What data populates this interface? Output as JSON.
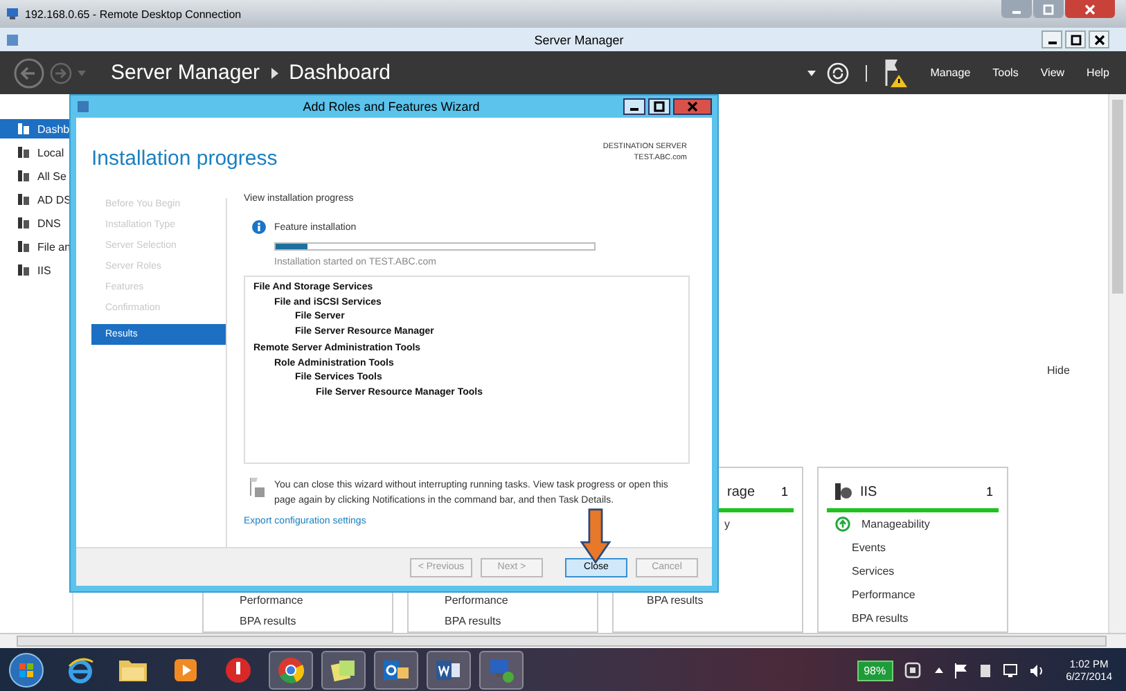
{
  "rdp_window": {
    "title": "192.168.0.65 - Remote Desktop Connection"
  },
  "app_window": {
    "title": "Server Manager"
  },
  "header": {
    "breadcrumb": [
      "Server Manager",
      "Dashboard"
    ],
    "menu": [
      "Manage",
      "Tools",
      "View",
      "Help"
    ]
  },
  "sidebar": {
    "items": [
      {
        "label": "Dashb",
        "selected": true
      },
      {
        "label": "Local",
        "selected": false
      },
      {
        "label": "All Se",
        "selected": false
      },
      {
        "label": "AD DS",
        "selected": false
      },
      {
        "label": "DNS",
        "selected": false
      },
      {
        "label": "File an",
        "selected": false
      },
      {
        "label": "IIS",
        "selected": false
      }
    ]
  },
  "dashboard": {
    "hide_link": "Hide",
    "tiles": [
      {
        "rows": [
          {
            "text": "Performance",
            "kind": "link"
          },
          {
            "text": "BPA results",
            "kind": "link"
          }
        ]
      },
      {
        "rows": [
          {
            "text": "Performance",
            "kind": "link"
          },
          {
            "text": "BPA results",
            "kind": "link"
          }
        ]
      },
      {
        "title": "rage",
        "count": "1",
        "rows": [
          {
            "text": "y",
            "kind": "link"
          },
          {
            "text": "BPA results",
            "kind": "link"
          }
        ]
      },
      {
        "title": "IIS",
        "count": "1",
        "rows": [
          {
            "text": "Manageability",
            "kind": "healthy"
          },
          {
            "text": "Events",
            "kind": "link"
          },
          {
            "text": "Services",
            "kind": "link"
          },
          {
            "text": "Performance",
            "kind": "link"
          },
          {
            "text": "BPA results",
            "kind": "link"
          }
        ]
      }
    ]
  },
  "wizard": {
    "title": "Add Roles and Features Wizard",
    "heading": "Installation progress",
    "destination_label": "DESTINATION SERVER",
    "destination_server": "TEST.ABC.com",
    "steps": [
      {
        "label": "Before You Begin",
        "selected": false
      },
      {
        "label": "Installation Type",
        "selected": false
      },
      {
        "label": "Server Selection",
        "selected": false
      },
      {
        "label": "Server Roles",
        "selected": false
      },
      {
        "label": "Features",
        "selected": false
      },
      {
        "label": "Confirmation",
        "selected": false
      },
      {
        "label": "Results",
        "selected": true
      }
    ],
    "section_label": "View installation progress",
    "status": "Feature installation",
    "level": 0.1,
    "started": "Installation started on TEST.ABC.com",
    "results": [
      {
        "label": "File And Storage Services",
        "children": [
          {
            "label": "File and iSCSI Services",
            "children": [
              {
                "label": "File Server"
              },
              {
                "label": "File Server Resource Manager"
              }
            ]
          }
        ]
      },
      {
        "label": "Remote Server Administration Tools",
        "children": [
          {
            "label": "Role Administration Tools",
            "children": [
              {
                "label": "File Services Tools",
                "children": [
                  {
                    "label": "File Server Resource Manager Tools"
                  }
                ]
              }
            ]
          }
        ]
      }
    ],
    "note": "You can close this wizard without interrupting running tasks. View task progress or open this page again by clicking Notifications in the command bar, and then Task Details.",
    "export_link": "Export configuration settings",
    "buttons": [
      {
        "label": "< Previous",
        "disabled": true,
        "default": false
      },
      {
        "label": "Next >",
        "disabled": true,
        "default": false
      },
      {
        "label": "Close",
        "disabled": false,
        "default": true
      },
      {
        "label": "Cancel",
        "disabled": true,
        "default": false
      }
    ]
  },
  "taskbar": {
    "battery": "98%",
    "time": "1:02 PM",
    "date": "6/27/2014"
  }
}
